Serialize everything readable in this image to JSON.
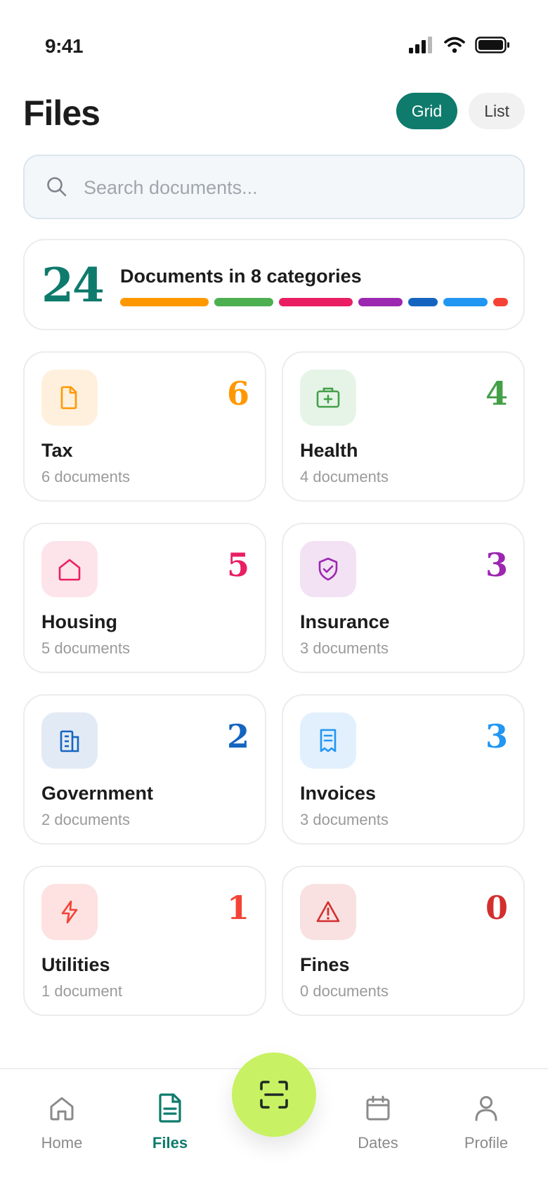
{
  "status_bar": {
    "time": "9:41"
  },
  "header": {
    "title": "Files"
  },
  "view_toggle": {
    "grid_label": "Grid",
    "list_label": "List",
    "selected": "Grid"
  },
  "search": {
    "placeholder": "Search documents...",
    "value": ""
  },
  "summary": {
    "count": "24",
    "text": "Documents in 8 categories",
    "bar_colors": [
      "#ff9800",
      "#4caf50",
      "#e91e63",
      "#9c27b0",
      "#1565c0",
      "#2196f3",
      "#f44336"
    ]
  },
  "categories": [
    {
      "name": "Tax",
      "count": "6",
      "subtitle": "6 documents",
      "icon": "document-icon",
      "color": "#ff9800",
      "bg": "#fff0dd"
    },
    {
      "name": "Health",
      "count": "4",
      "subtitle": "4 documents",
      "icon": "medical-kit-icon",
      "color": "#43a047",
      "bg": "#e6f4e7"
    },
    {
      "name": "Housing",
      "count": "5",
      "subtitle": "5 documents",
      "icon": "house-icon",
      "color": "#e91e63",
      "bg": "#fde3ea"
    },
    {
      "name": "Insurance",
      "count": "3",
      "subtitle": "3 documents",
      "icon": "shield-check-icon",
      "color": "#9c27b0",
      "bg": "#f2e2f4"
    },
    {
      "name": "Government",
      "count": "2",
      "subtitle": "2 documents",
      "icon": "building-icon",
      "color": "#1565c0",
      "bg": "#e2eaf5"
    },
    {
      "name": "Invoices",
      "count": "3",
      "subtitle": "3 documents",
      "icon": "receipt-icon",
      "color": "#2196f3",
      "bg": "#e1f0fc"
    },
    {
      "name": "Utilities",
      "count": "1",
      "subtitle": "1 document",
      "icon": "lightning-icon",
      "color": "#f44336",
      "bg": "#fde2e1"
    },
    {
      "name": "Fines",
      "count": "0",
      "subtitle": "0 documents",
      "icon": "warning-icon",
      "color": "#d32f2f",
      "bg": "#f9e1e1"
    }
  ],
  "bottom_nav": {
    "items": [
      {
        "label": "Home",
        "icon": "home-icon"
      },
      {
        "label": "Files",
        "icon": "file-icon",
        "active": true
      },
      {
        "label": "Dates",
        "icon": "calendar-icon"
      },
      {
        "label": "Profile",
        "icon": "person-icon"
      }
    ],
    "fab_icon": "scan-icon"
  }
}
